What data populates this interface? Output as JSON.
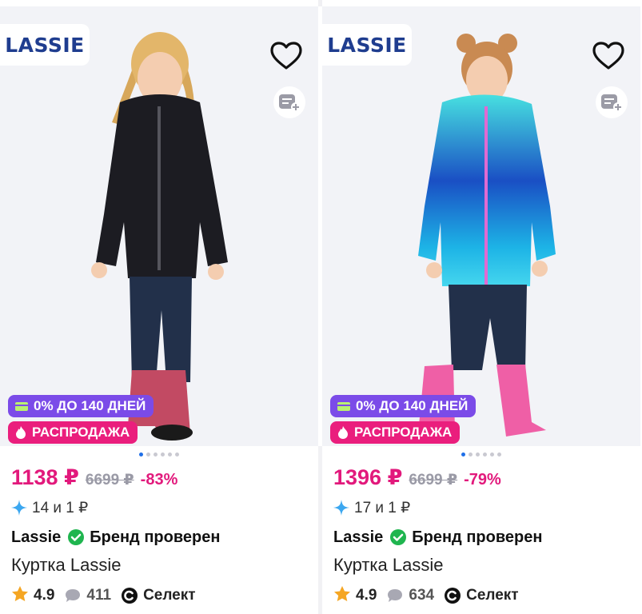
{
  "colors": {
    "accent": "#e2197c",
    "installment_badge": "#7b4be8",
    "sale_badge": "#ea1e7d",
    "brand_check": "#1fb54f",
    "star": "#f5a623"
  },
  "products": [
    {
      "brand_logo": "LASSIE",
      "jacket_color": "#1c1c22",
      "installment_badge": "0% ДО 140 ДНЕЙ",
      "sale_badge": "РАСПРОДАЖА",
      "price": "1138 ₽",
      "old_price": "6699 ₽",
      "discount": "-83%",
      "bonus": "14 и 1 ₽",
      "brand": "Lassie",
      "verified": "Бренд проверен",
      "name": "Куртка Lassie",
      "rating": "4.9",
      "reviews": "411",
      "select": "Селект"
    },
    {
      "brand_logo": "LASSIE",
      "jacket_color": "#2aa9e6",
      "installment_badge": "0% ДО 140 ДНЕЙ",
      "sale_badge": "РАСПРОДАЖА",
      "price": "1396 ₽",
      "old_price": "6699 ₽",
      "discount": "-79%",
      "bonus": "17 и 1 ₽",
      "brand": "Lassie",
      "verified": "Бренд проверен",
      "name": "Куртка Lassie",
      "rating": "4.9",
      "reviews": "634",
      "select": "Селект"
    }
  ],
  "icons": [
    "heart-icon",
    "compare-icon",
    "card-icon",
    "fire-icon",
    "sparkle-icon",
    "check-icon",
    "star-icon",
    "comment-icon",
    "select-icon"
  ]
}
